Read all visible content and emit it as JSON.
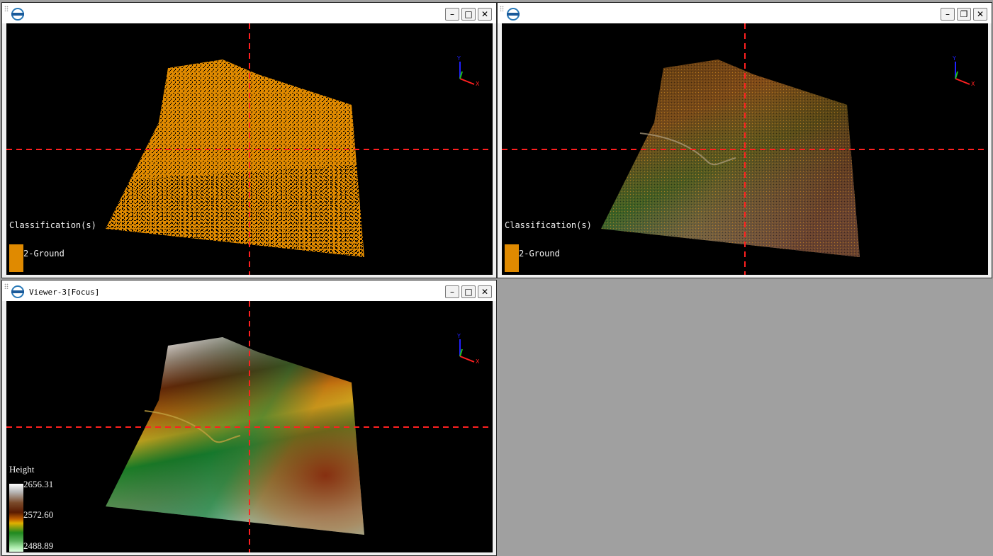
{
  "viewers": [
    {
      "title": "",
      "controls": {
        "minimize": "–",
        "maximize": "□",
        "close": "✕"
      },
      "legend": {
        "title": "Classification(s)",
        "items": [
          {
            "label": "2-Ground",
            "color": "#e08a00"
          }
        ]
      },
      "render_mode": "classification"
    },
    {
      "title": "",
      "controls": {
        "minimize": "–",
        "restore": "❐",
        "close": "✕"
      },
      "legend": {
        "title": "Classification(s)",
        "items": [
          {
            "label": "2-Ground",
            "color": "#e08a00"
          }
        ]
      },
      "render_mode": "rgb"
    },
    {
      "title": "Viewer-3[Focus]",
      "controls": {
        "minimize": "–",
        "maximize": "□",
        "close": "✕"
      },
      "legend": {
        "title": "Height",
        "max": "2656.31",
        "mid": "2572.60",
        "min": "2488.89"
      },
      "render_mode": "height"
    }
  ],
  "axis": {
    "x": "X",
    "y": "Y",
    "z": "Z"
  },
  "colors": {
    "ground": "#e08a00",
    "crosshair": "#ff2020",
    "empty_area": "#a0a0a0"
  },
  "icons": [
    "grip-icon",
    "lidar-logo-icon",
    "minimize-icon",
    "maximize-icon",
    "restore-icon",
    "close-icon",
    "axis-triad-icon"
  ]
}
